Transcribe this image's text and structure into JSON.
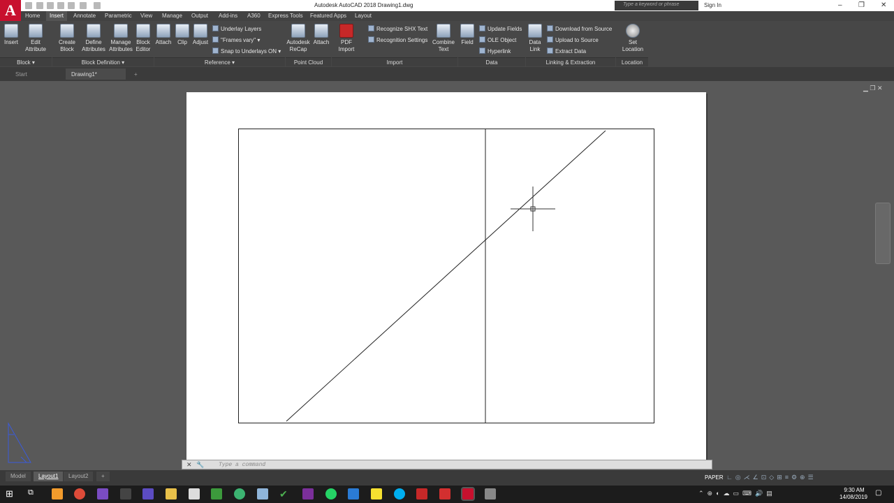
{
  "app": {
    "logo_letter": "A",
    "title": "Autodesk AutoCAD 2018    Drawing1.dwg"
  },
  "search": {
    "placeholder": "Type a keyword or phrase"
  },
  "account": {
    "signin": "Sign In"
  },
  "ribbon_tabs": [
    "Home",
    "Insert",
    "Annotate",
    "Parametric",
    "View",
    "Manage",
    "Output",
    "Add-ins",
    "A360",
    "Express Tools",
    "Featured Apps",
    "Layout"
  ],
  "ribbon": {
    "insert": "Insert",
    "edit_attribute": "Edit\nAttribute",
    "create_block": "Create\nBlock",
    "define_attributes": "Define\nAttributes",
    "manage_attributes": "Manage\nAttributes",
    "block_editor": "Block\nEditor",
    "attach": "Attach",
    "clip": "Clip",
    "adjust": "Adjust",
    "underlay_layers": "Underlay Layers",
    "frames_vary": "\"Frames vary\"",
    "snap_underlays": "Snap to Underlays ON",
    "recap": "Autodesk\nReCap",
    "attach2": "Attach",
    "pdf_import": "PDF\nImport",
    "recognize_shx": "Recognize SHX Text",
    "recognition_settings": "Recognition Settings",
    "combine_text": "Combine\nText",
    "field": "Field",
    "update_fields": "Update Fields",
    "ole_object": "OLE Object",
    "hyperlink": "Hyperlink",
    "data_link": "Data\nLink",
    "download_source": "Download from Source",
    "upload_source": "Upload to Source",
    "extract_data": "Extract  Data",
    "set_location": "Set\nLocation"
  },
  "panels": {
    "block": "Block",
    "block_definition": "Block Definition",
    "reference": "Reference",
    "point_cloud": "Point Cloud",
    "import": "Import",
    "data": "Data",
    "linking": "Linking & Extraction",
    "location": "Location"
  },
  "file_tabs": {
    "start": "Start",
    "drawing": "Drawing1*",
    "plus": "+"
  },
  "command": {
    "placeholder": "Type  a  command"
  },
  "layout_tabs": {
    "model": "Model",
    "layout1": "Layout1",
    "layout2": "Layout2",
    "plus": "+"
  },
  "status": {
    "paper": "PAPER"
  },
  "clock": {
    "time": "9:30 AM",
    "date": "14/08/2019"
  }
}
